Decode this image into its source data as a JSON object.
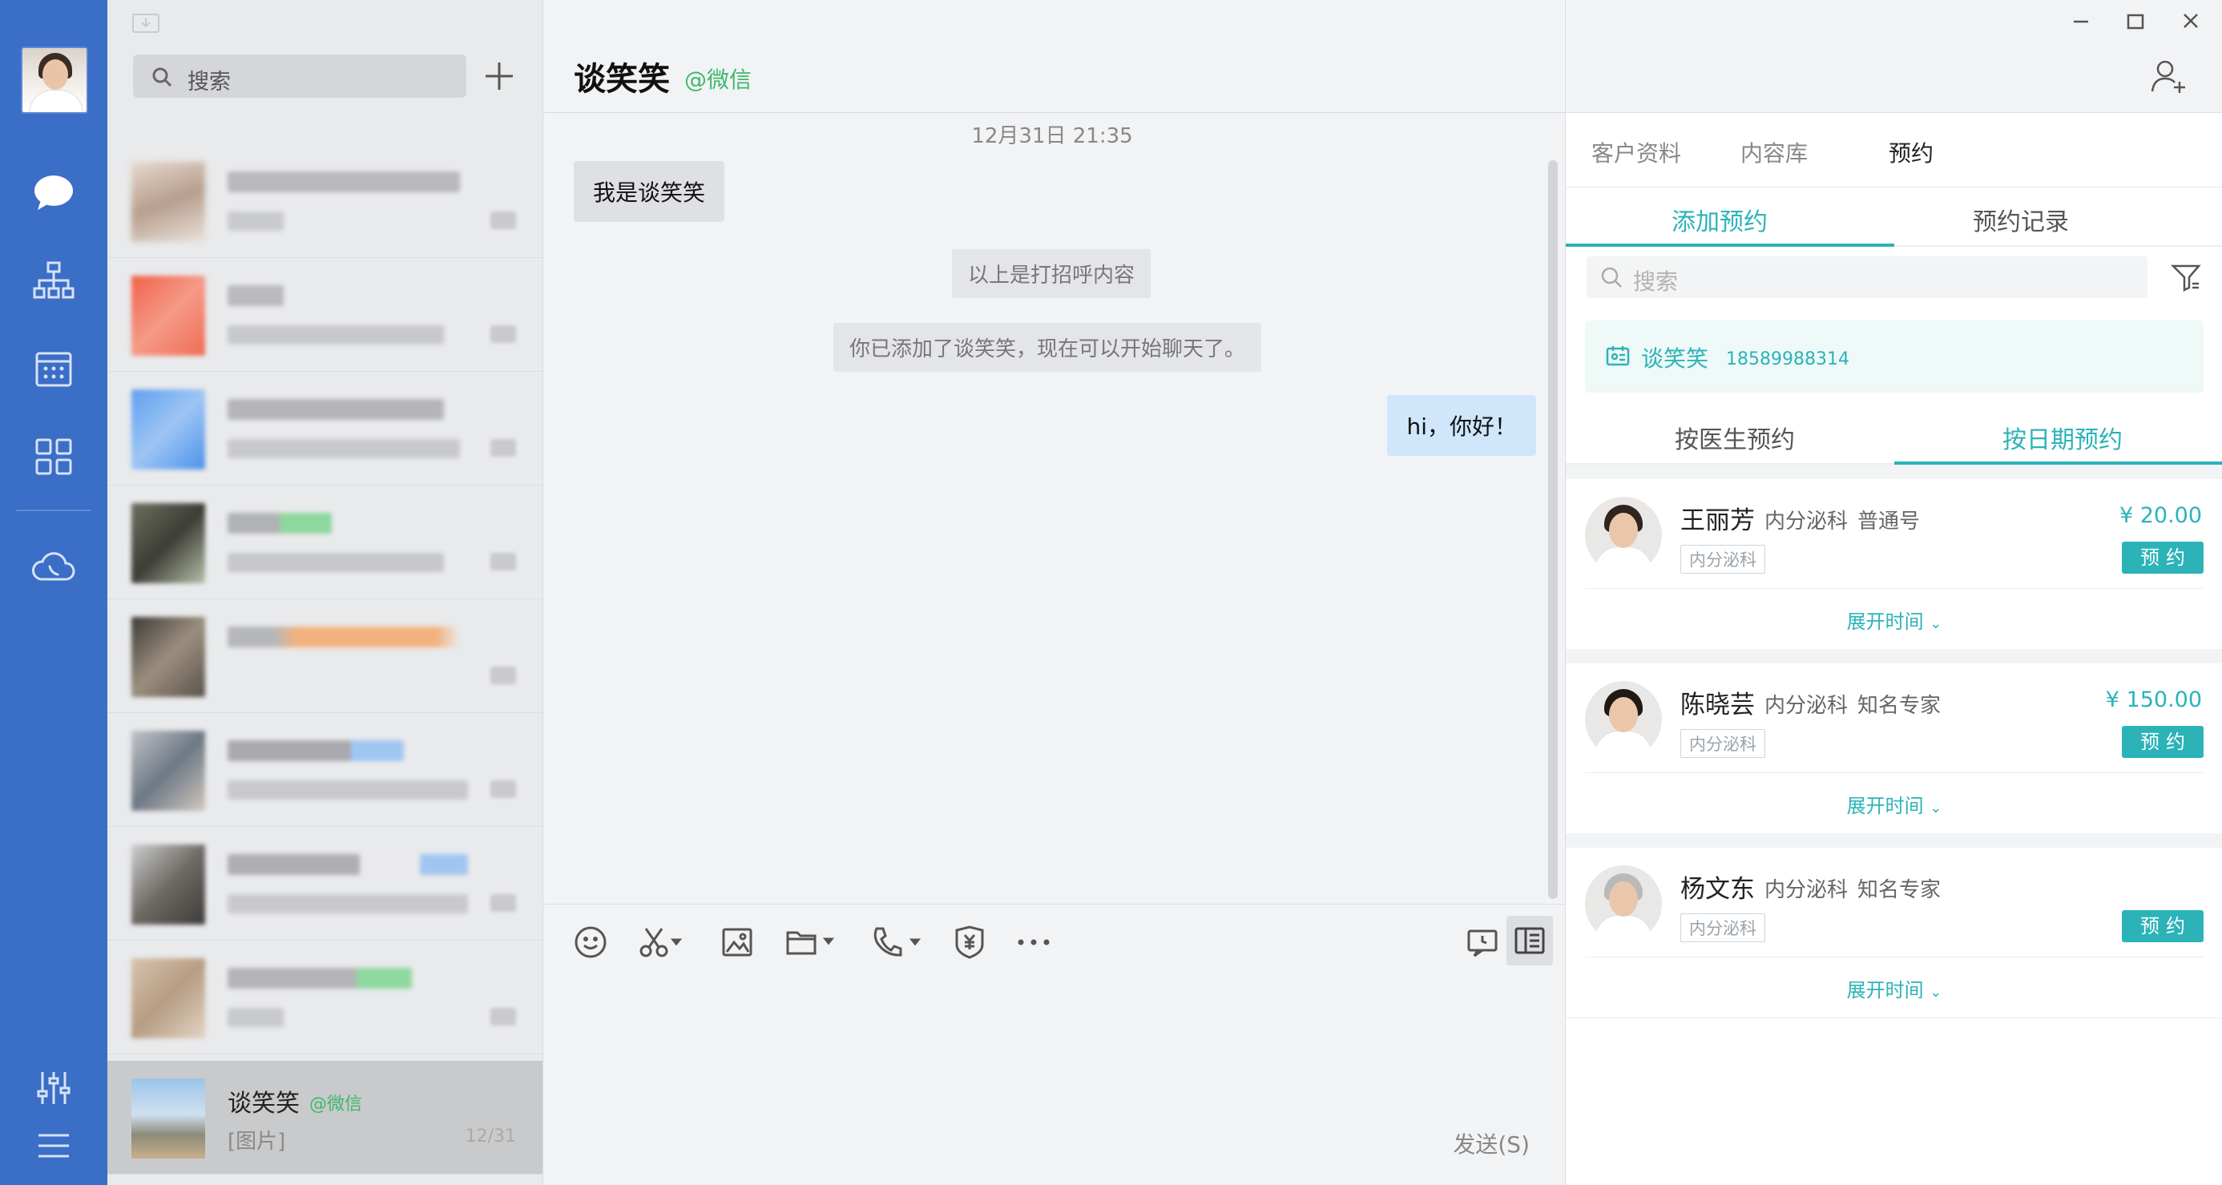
{
  "sidebar": {
    "nav": [
      "chat-bubble-icon",
      "org-tree-icon",
      "calendar-icon",
      "apps-grid-icon",
      "cloud-phone-icon"
    ],
    "bottom": [
      "sliders-icon",
      "hamburger-menu-icon"
    ]
  },
  "convlist": {
    "search_placeholder": "搜索",
    "active": {
      "name": "谈笑笑",
      "tag": "@微信",
      "preview": "[图片]",
      "time": "12/31"
    }
  },
  "chat": {
    "title": "谈笑笑",
    "tag": "@微信",
    "timestamp": "12月31日 21:35",
    "msg_in": "我是谈笑笑",
    "sys1": "以上是打招呼内容",
    "sys2": "你已添加了谈笑笑，现在可以开始聊天了。",
    "msg_out": "hi，你好！",
    "send_label": "发送(S)"
  },
  "panel": {
    "tabs": [
      "客户资料",
      "内容库",
      "预约"
    ],
    "subtabs": [
      "添加预约",
      "预约记录"
    ],
    "search_placeholder": "搜索",
    "customer": {
      "name": "谈笑笑",
      "phone": "18589988314"
    },
    "modetabs": [
      "按医生预约",
      "按日期预约"
    ],
    "doctors": [
      {
        "name": "王丽芳",
        "dept": "内分泌科",
        "level": "普通号",
        "chip": "内分泌科",
        "price": "¥ 20.00",
        "button": "预约",
        "expand": "展开时间"
      },
      {
        "name": "陈晓芸",
        "dept": "内分泌科",
        "level": "知名专家",
        "chip": "内分泌科",
        "price": "¥ 150.00",
        "button": "预约",
        "expand": "展开时间"
      },
      {
        "name": "杨文东",
        "dept": "内分泌科",
        "level": "知名专家",
        "chip": "内分泌科",
        "price": "",
        "button": "预约",
        "expand": "展开时间"
      }
    ]
  },
  "colors": {
    "rail": "#3b6ec6",
    "accent": "#2bb3b8",
    "wechat_green": "#3eb86b",
    "out_bubble": "#cfe6fb"
  }
}
